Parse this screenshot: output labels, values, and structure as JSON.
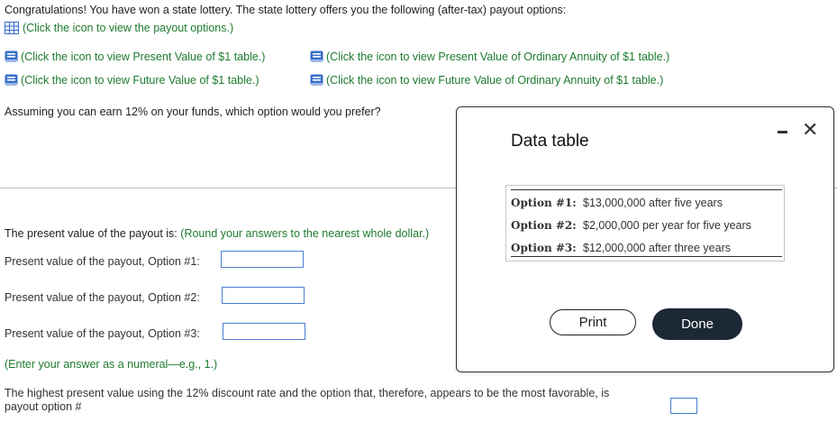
{
  "intro": "Congratulations! You have won a state lottery. The state lottery offers you the following (after-tax) payout options:",
  "payout_link": "(Click the icon to view the payout options.)",
  "table_links": {
    "pv": "(Click the icon to view Present Value of $1 table.)",
    "pvoa": "(Click the icon to view Present Value of Ordinary Annuity of $1 table.)",
    "fv": "(Click the icon to view Future Value of $1 table.)",
    "fvoa": "(Click the icon to view Future Value of Ordinary Annuity of $1 table.)"
  },
  "question": "Assuming you can earn 12% on your funds, which option would you prefer?",
  "pv_prompt": "The present value of the payout is:",
  "pv_prompt_note": "(Round your answers to the nearest whole dollar.)",
  "fields": {
    "opt1_label": "Present value of the payout, Option #1:",
    "opt2_label": "Present value of the payout, Option #2:",
    "opt3_label": "Present value of the payout, Option #3:"
  },
  "enter_note": "(Enter your answer as a numeral—e.g., 1.)",
  "final_q1": "The highest present value using the 12% discount rate and the option that, therefore, appears to be the most favorable, is",
  "final_q2": "payout option #",
  "modal": {
    "title": "Data table",
    "rows": [
      {
        "key": "Option #1:",
        "value": "$13,000,000 after five years"
      },
      {
        "key": "Option #2:",
        "value": "$2,000,000 per year for five years"
      },
      {
        "key": "Option #3:",
        "value": "$12,000,000 after three years"
      }
    ],
    "print_label": "Print",
    "done_label": "Done",
    "close_glyph": "✕"
  },
  "colors": {
    "link_green": "#1e7b2e",
    "input_border": "#4a7fd0",
    "done_bg": "#1d2836",
    "book_blue": "#3a6fc9"
  }
}
